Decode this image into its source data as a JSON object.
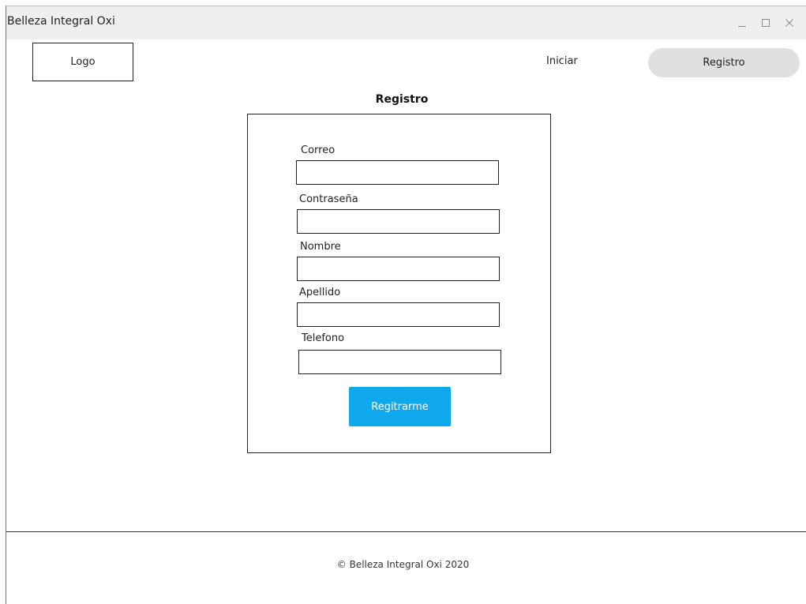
{
  "window": {
    "title": "Belleza Integral Oxi"
  },
  "header": {
    "logo_label": "Logo",
    "nav": {
      "login_label": "Iniciar",
      "register_label": "Registro"
    }
  },
  "form": {
    "title": "Registro",
    "fields": [
      {
        "label": "Correo",
        "value": "",
        "placeholder": ""
      },
      {
        "label": "Contraseña",
        "value": "",
        "placeholder": ""
      },
      {
        "label": "Nombre",
        "value": "",
        "placeholder": ""
      },
      {
        "label": "Apellido",
        "value": "",
        "placeholder": ""
      },
      {
        "label": "Telefono",
        "value": "",
        "placeholder": ""
      }
    ],
    "submit_label": "Regitrarme"
  },
  "footer": {
    "text": "© Belleza Integral Oxi 2020"
  },
  "colors": {
    "titlebar_bg": "#efefef",
    "nav_pill_bg": "#e0e0e0",
    "submit_bg": "#10a8ec",
    "submit_text": "#ffffff"
  },
  "icons": {
    "minimize": "minimize-icon",
    "maximize": "maximize-icon",
    "close": "close-icon"
  }
}
